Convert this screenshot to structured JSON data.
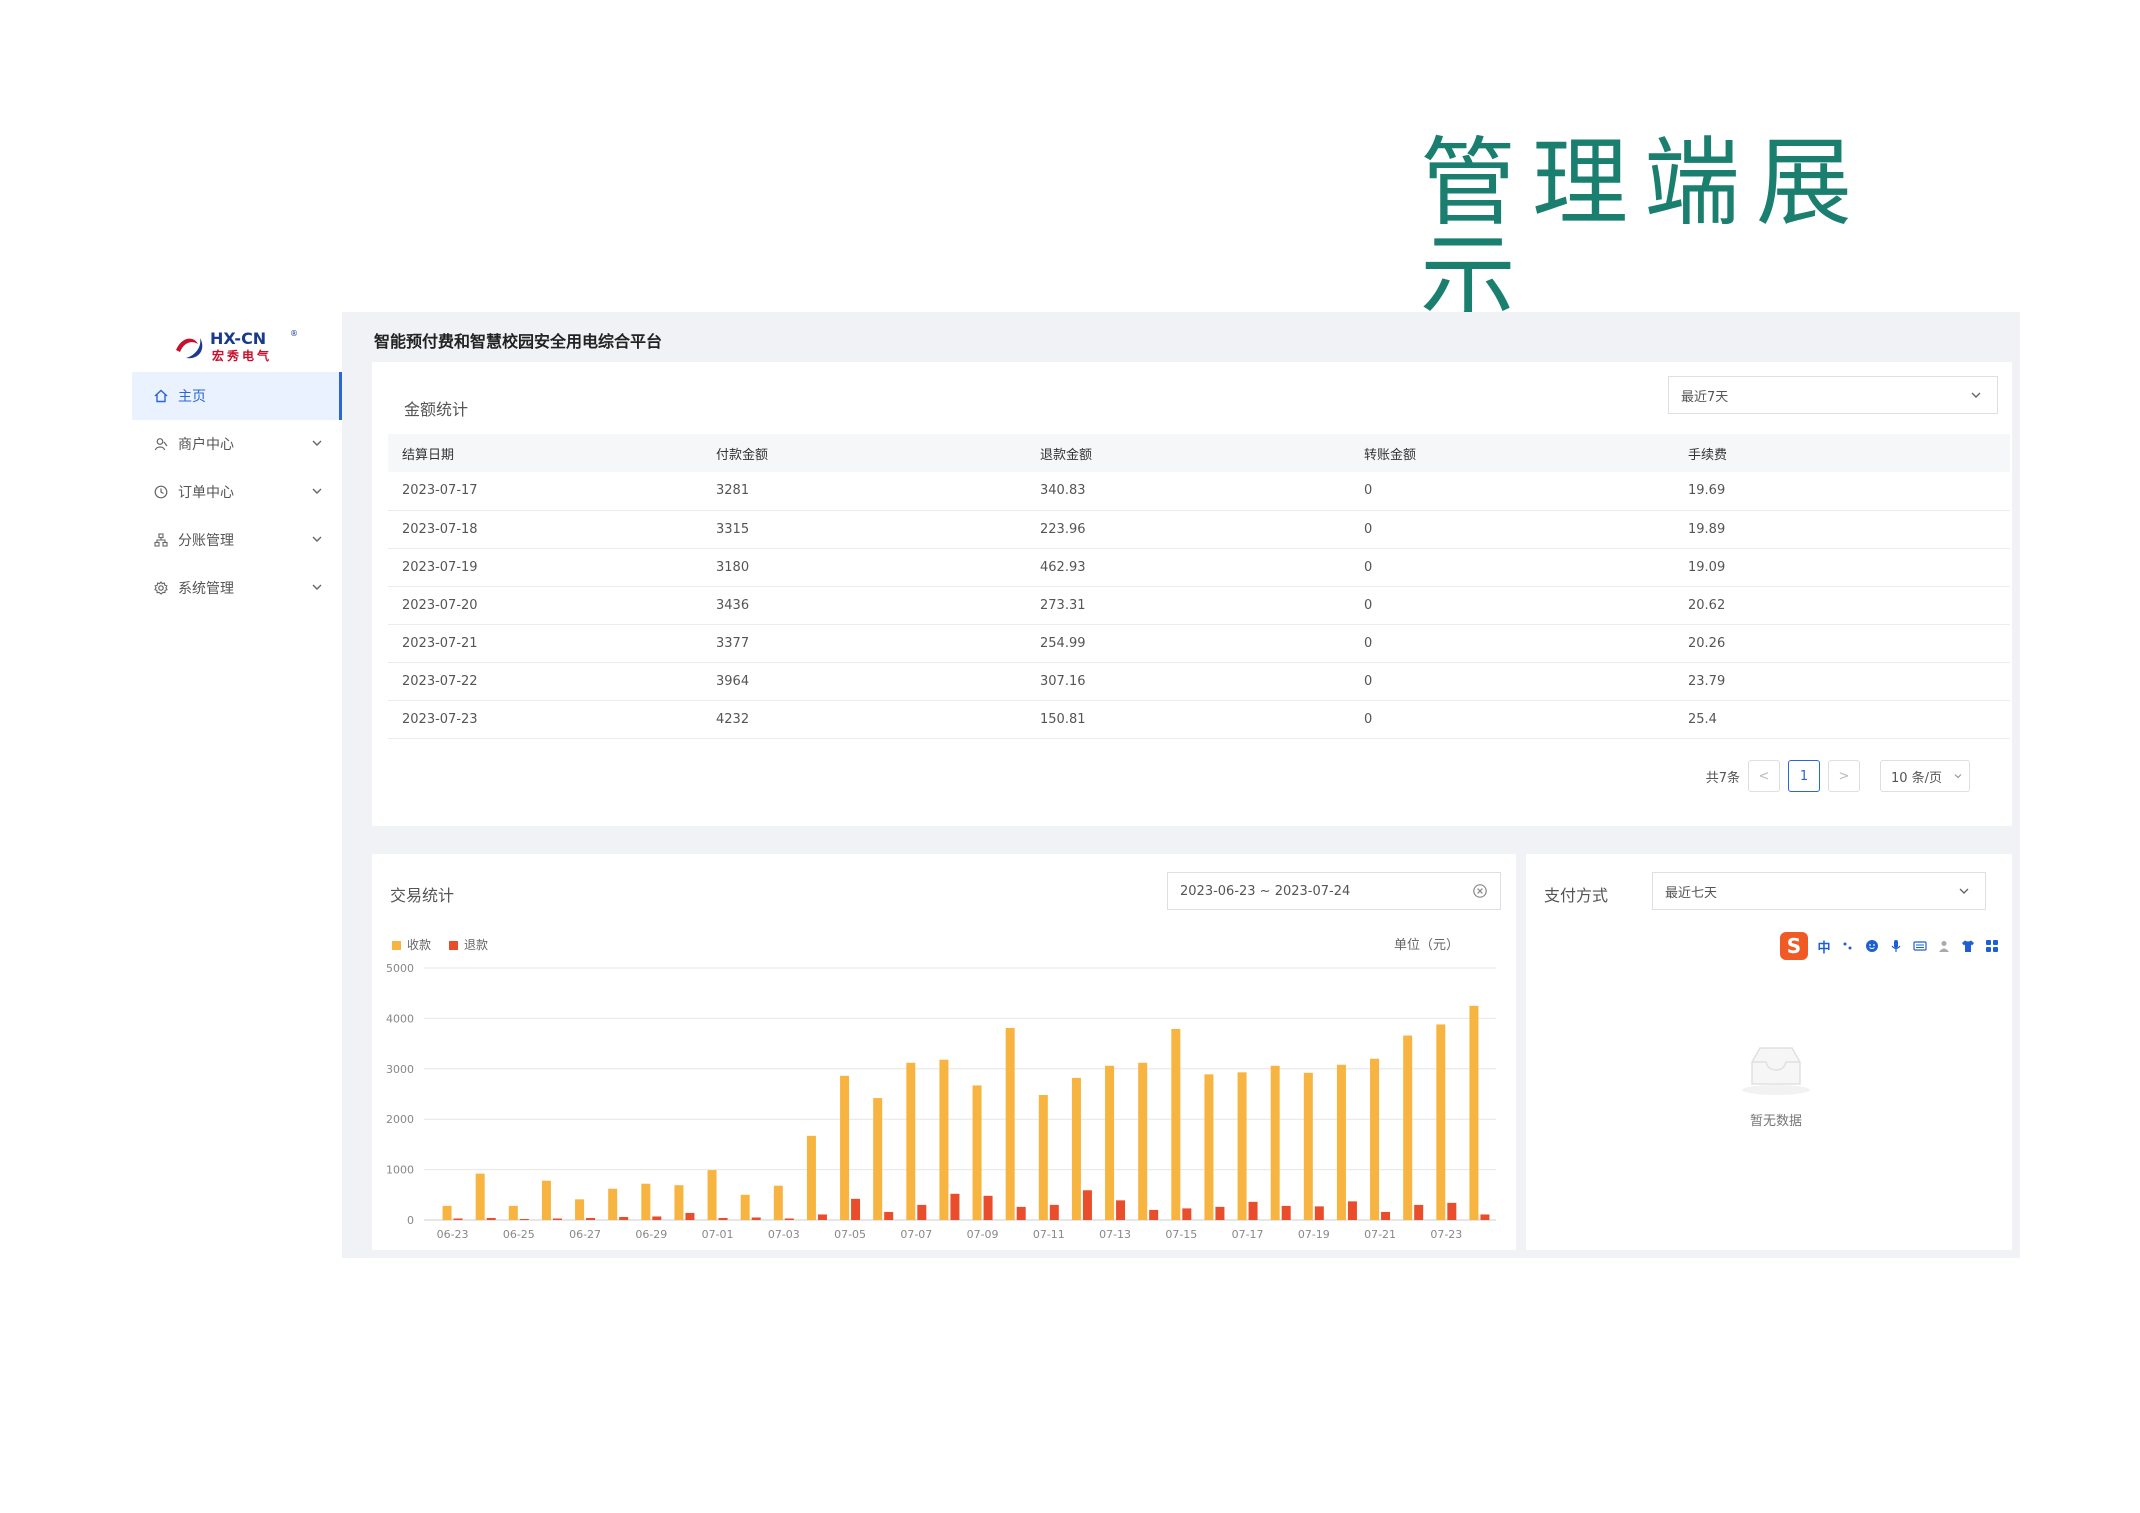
{
  "page": {
    "heading": "管理端展示"
  },
  "brand": {
    "logo_text": "HX-CN",
    "logo_subtext": "宏秀电气",
    "logo_mark": "®"
  },
  "app": {
    "title": "智能预付费和智慧校园安全用电综合平台"
  },
  "sidebar": {
    "items": [
      {
        "label": "主页",
        "icon": "home-icon",
        "active": true
      },
      {
        "label": "商户中心",
        "icon": "merchant-icon",
        "expandable": true
      },
      {
        "label": "订单中心",
        "icon": "order-icon",
        "expandable": true
      },
      {
        "label": "分账管理",
        "icon": "split-account-icon",
        "expandable": true
      },
      {
        "label": "系统管理",
        "icon": "settings-icon",
        "expandable": true
      }
    ]
  },
  "amount_stats": {
    "title": "金额统计",
    "period_select": "最近7天",
    "columns": [
      "结算日期",
      "付款金额",
      "退款金额",
      "转账金额",
      "手续费"
    ],
    "rows": [
      [
        "2023-07-17",
        "3281",
        "340.83",
        "0",
        "19.69"
      ],
      [
        "2023-07-18",
        "3315",
        "223.96",
        "0",
        "19.89"
      ],
      [
        "2023-07-19",
        "3180",
        "462.93",
        "0",
        "19.09"
      ],
      [
        "2023-07-20",
        "3436",
        "273.31",
        "0",
        "20.62"
      ],
      [
        "2023-07-21",
        "3377",
        "254.99",
        "0",
        "20.26"
      ],
      [
        "2023-07-22",
        "3964",
        "307.16",
        "0",
        "23.79"
      ],
      [
        "2023-07-23",
        "4232",
        "150.81",
        "0",
        "25.4"
      ]
    ],
    "pagination": {
      "total": "共7条",
      "prev": "<",
      "page": "1",
      "next": ">",
      "page_size": "10 条/页"
    }
  },
  "trade_stats": {
    "title": "交易统计",
    "date_range": "2023-06-23 ~ 2023-07-24",
    "unit": "单位（元）",
    "colors": {
      "income": "#f7b441",
      "refund": "#ea4d2c",
      "grid": "#e6e6e6"
    }
  },
  "chart_data": {
    "type": "bar",
    "categories": [
      "06-23",
      "06-24",
      "06-25",
      "06-26",
      "06-27",
      "06-28",
      "06-29",
      "06-30",
      "07-01",
      "07-02",
      "07-03",
      "07-04",
      "07-05",
      "07-06",
      "07-07",
      "07-08",
      "07-09",
      "07-10",
      "07-11",
      "07-12",
      "07-13",
      "07-14",
      "07-15",
      "07-16",
      "07-17",
      "07-18",
      "07-19",
      "07-20",
      "07-21",
      "07-22",
      "07-23"
    ],
    "tick_labels": [
      "06-23",
      "06-25",
      "06-27",
      "06-29",
      "07-01",
      "07-03",
      "07-05",
      "07-07",
      "07-09",
      "07-11",
      "07-13",
      "07-15",
      "07-17",
      "07-19",
      "07-21",
      "07-23"
    ],
    "series": [
      {
        "name": "收款",
        "values": [
          280,
          920,
          280,
          780,
          410,
          620,
          720,
          690,
          990,
          500,
          680,
          1670,
          2860,
          2420,
          3120,
          3180,
          2670,
          3810,
          2480,
          2820,
          3060,
          3120,
          3790,
          2890,
          2930,
          3060,
          2920,
          3080,
          3200,
          3660,
          3880,
          4250
        ]
      },
      {
        "name": "退款",
        "values": [
          30,
          40,
          20,
          30,
          40,
          60,
          70,
          140,
          40,
          50,
          30,
          110,
          420,
          160,
          300,
          520,
          480,
          260,
          300,
          590,
          390,
          200,
          230,
          260,
          360,
          280,
          270,
          370,
          160,
          300,
          340,
          110
        ]
      }
    ],
    "yticks": [
      0,
      1000,
      2000,
      3000,
      4000,
      5000
    ],
    "ylim": [
      0,
      5000
    ],
    "legend_position": "top-left",
    "grid": true
  },
  "payment_method": {
    "title": "支付方式",
    "period_select": "最近七天",
    "empty_text": "暂无数据",
    "ime_toolbar": {
      "logo": "S",
      "mode": "中"
    }
  }
}
